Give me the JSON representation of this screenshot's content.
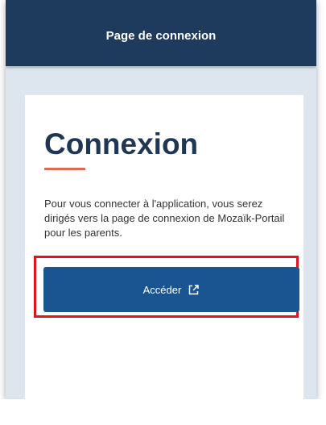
{
  "appbar": {
    "title": "Page de connexion"
  },
  "login_card": {
    "title": "Connexion",
    "description": "Pour vous connecter à l'application, vous serez dirigés vers la page de connexion de Mozaïk-Portail pour les parents.",
    "access_button_label": "Accéder",
    "access_button_icon": "external-link-icon"
  },
  "colors": {
    "appbar_bg": "#1e3a5c",
    "page_bg": "#dde6ef",
    "title_text": "#1f3654",
    "accent_underline": "#e06a4e",
    "button_bg": "#1b5591",
    "highlight_border": "#e0141e"
  }
}
